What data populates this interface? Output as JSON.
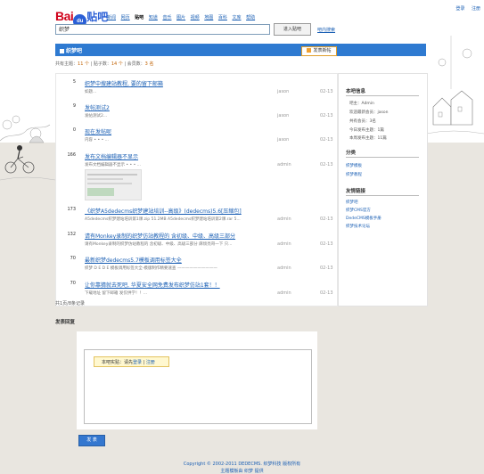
{
  "top_links": [
    "登录",
    "注册"
  ],
  "logo": {
    "part1": "Bai",
    "part2": "du",
    "part3": "贴吧"
  },
  "nav": [
    {
      "label": "新闻",
      "active": false
    },
    {
      "label": "网页",
      "active": false
    },
    {
      "label": "贴吧",
      "active": true
    },
    {
      "label": "知道",
      "active": false
    },
    {
      "label": "音乐",
      "active": false
    },
    {
      "label": "图片",
      "active": false
    },
    {
      "label": "视频",
      "active": false
    },
    {
      "label": "地图",
      "active": false
    },
    {
      "label": "百科",
      "active": false
    },
    {
      "label": "文库",
      "active": false
    },
    {
      "label": "帮助",
      "active": false
    }
  ],
  "search": {
    "value": "织梦",
    "button": "进入贴吧",
    "advanced": "吧内搜索"
  },
  "forum": {
    "title": "织梦吧",
    "post_button": "发表新帖"
  },
  "stats": {
    "topics_label": "共有主题：",
    "topics_value": "11 个",
    "replies_label": "| 贴子数：",
    "replies_value": "14 个",
    "members_label": "| 会员数：",
    "members_value": "3 名"
  },
  "threads": [
    {
      "replies": "5",
      "title": "织梦中搜建站教程, 要的留下邮箱",
      "abstract": "如题...",
      "author": "jason",
      "date": "02-13"
    },
    {
      "replies": "9",
      "title": "发帖测试2",
      "abstract": "发帖测试2...",
      "author": "jason",
      "date": "02-13"
    },
    {
      "replies": "0",
      "title": "现在发帖呢",
      "abstract": "内容 • • • ...",
      "author": "jason",
      "date": "02-13"
    },
    {
      "replies": "166",
      "title": "发布文档编辑器不显示",
      "abstract": "发布文档编辑器不显示 • • • ...",
      "author": "admin",
      "date": "02-13"
    },
    {
      "replies": "173",
      "title": "《织梦A5dedecms织梦建站培训--高级》(dedecms)5.6[压缩包]",
      "abstract": "A5dedecms织梦建站培训第1课.zip 51.2MB A5dedecms织梦建站培训第2课.rar 5...",
      "author": "admin",
      "date": "02-13"
    },
    {
      "replies": "132",
      "title": "请有Monkey录制的织梦仿站教程的 含初级、中级、高级三部分",
      "abstract": "请有Monkey录制的织梦仿站教程的 含初级、中级、高级三部分 麻烦亮哥一下 只...",
      "author": "admin",
      "date": "02-13"
    },
    {
      "replies": "70",
      "title": "最新织梦dedecms5.7模板调用标签大全",
      "abstract": "织梦 D E D E 模板调用标签大全-模版制作精要速查 ——————————",
      "author": "admin",
      "date": "02-13"
    },
    {
      "replies": "70",
      "title": "让你靠猜就去死吧, 华夏安全网免费发布织梦仿站1套！！",
      "abstract": "下载地址 留下邮箱 发仅供学！！...",
      "author": "admin",
      "date": "02-13"
    }
  ],
  "total_text": "共1页/8条记录",
  "sidebar": {
    "info_title": "本吧信息",
    "info_lines": [
      "吧主：Admin",
      "欢迎最新会员：jason",
      "共有会员：3名",
      "今日发布主题：1篇",
      "本周发布主题：11篇"
    ],
    "cat_title": "分类",
    "cat_links": [
      "织梦模板",
      "织梦教程"
    ],
    "friend_title": "友情链接",
    "friend_links": [
      "织梦吧",
      "织梦CMS官方",
      "DedeCMS模板手册",
      "织梦技术论坛"
    ]
  },
  "reply": {
    "heading": "发表回复",
    "login_prefix": "本吧实贴：请先",
    "login_link": "登录",
    "sep": " | ",
    "register_link": "注册",
    "submit": "发 表"
  },
  "footer": {
    "line1": "Copyright © 2002-2011 DEDECMS. 织梦科技 版权所有",
    "line2": "主题模板由 织梦 提供"
  }
}
